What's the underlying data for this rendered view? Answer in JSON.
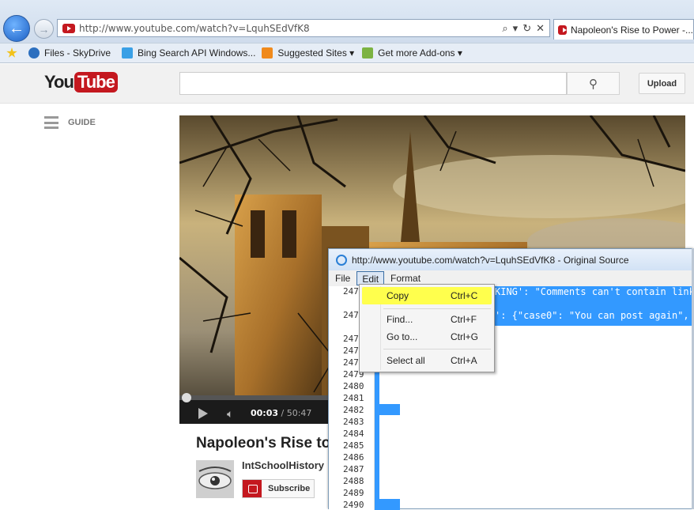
{
  "browser": {
    "url": "http://www.youtube.com/watch?v=LquhSEdVfK8",
    "tab_title": "Napoleon's Rise to Power -...",
    "favorites": [
      {
        "label": "Files - SkyDrive"
      },
      {
        "label": "Bing Search API  Windows..."
      },
      {
        "label": "Suggested Sites ▾"
      },
      {
        "label": "Get more Add-ons ▾"
      }
    ]
  },
  "youtube": {
    "logo_you": "You",
    "logo_tube": "Tube",
    "upload_label": "Upload",
    "guide_label": "GUIDE",
    "video": {
      "time_current": "00:03",
      "time_total": "/ 50:47",
      "progress_fraction": 0.001
    },
    "title": "Napoleon's Rise to",
    "channel": "IntSchoolHistory",
    "subscribe_label": "Subscribe"
  },
  "source_window": {
    "title": "http://www.youtube.com/watch?v=LquhSEdVfK8 - Original Source",
    "menu": [
      "File",
      "Edit",
      "Format"
    ],
    "line_numbers": [
      "247",
      "247",
      "247",
      "247",
      "247",
      "2479",
      "2480",
      "2481",
      "2482",
      "2483",
      "2484",
      "2485",
      "2486",
      "2487",
      "2488",
      "2489",
      "2490"
    ],
    "code_line_1": "KING': \"Comments can't contain links",
    "code_line_2": "': {\"case0\": \"You can post again\", \""
  },
  "edit_menu": {
    "items": [
      {
        "label": "Copy",
        "shortcut": "Ctrl+C"
      },
      {
        "label": "Find...",
        "shortcut": "Ctrl+F"
      },
      {
        "label": "Go to...",
        "shortcut": "Ctrl+G"
      },
      {
        "label": "Select all",
        "shortcut": "Ctrl+A"
      }
    ]
  },
  "colors": {
    "youtube_red": "#c4181f",
    "selection_blue": "#3399ff",
    "highlight_yellow": "#ffff4d"
  }
}
